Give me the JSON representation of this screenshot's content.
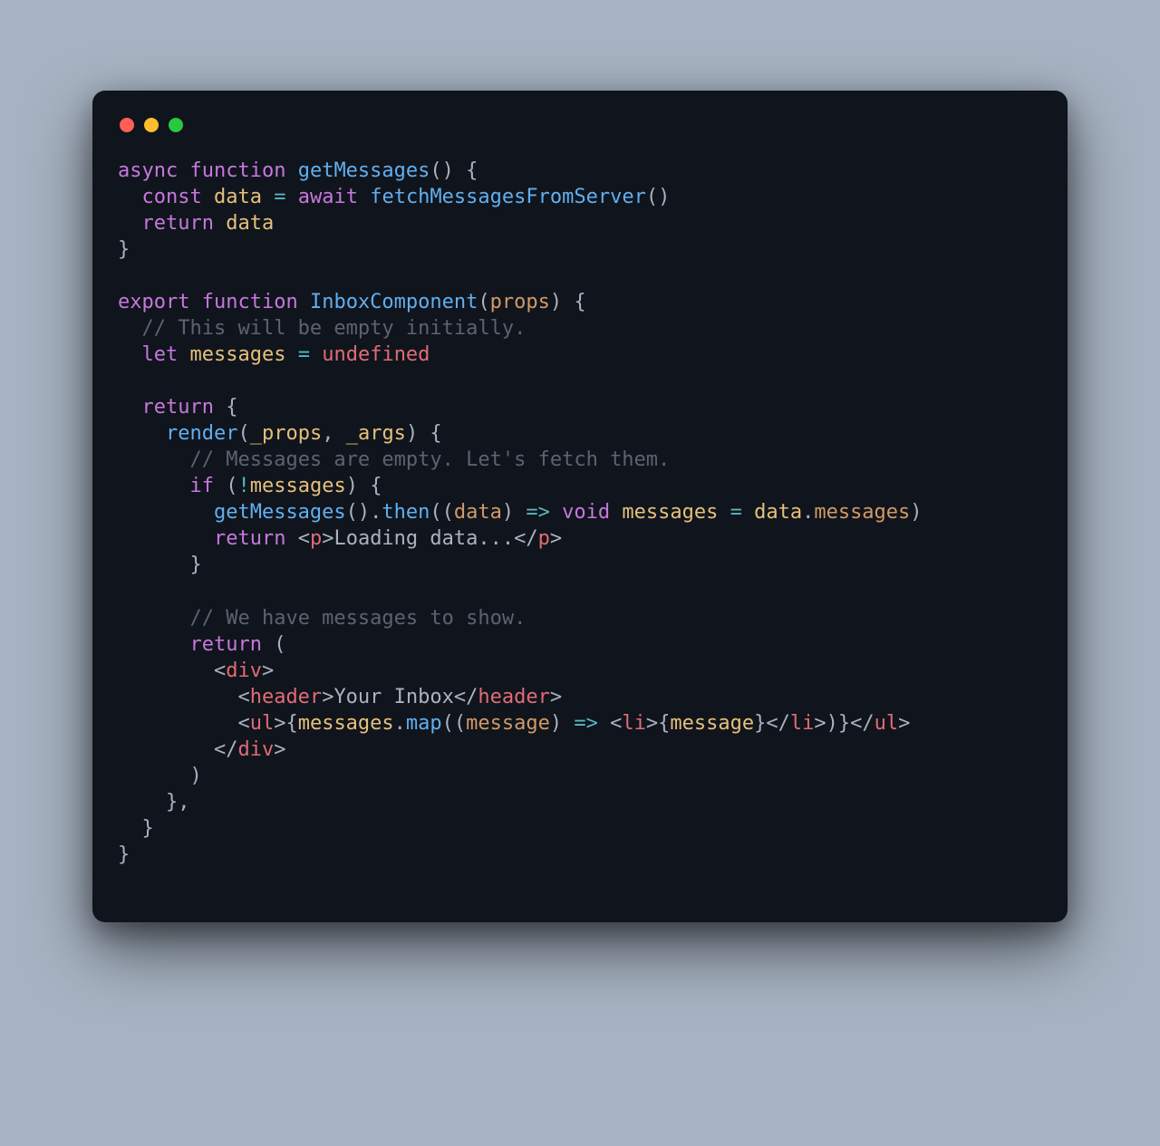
{
  "window": {
    "traffic_lights": [
      "red",
      "yellow",
      "green"
    ]
  },
  "code": {
    "lines": [
      [
        [
          "kw",
          "async"
        ],
        [
          "pn",
          " "
        ],
        [
          "kw",
          "function"
        ],
        [
          "pn",
          " "
        ],
        [
          "fn",
          "getMessages"
        ],
        [
          "pn",
          "() {"
        ]
      ],
      [
        [
          "pn",
          "  "
        ],
        [
          "kw",
          "const"
        ],
        [
          "pn",
          " "
        ],
        [
          "id",
          "data"
        ],
        [
          "pn",
          " "
        ],
        [
          "op",
          "="
        ],
        [
          "pn",
          " "
        ],
        [
          "kw",
          "await"
        ],
        [
          "pn",
          " "
        ],
        [
          "fn",
          "fetchMessagesFromServer"
        ],
        [
          "pn",
          "()"
        ]
      ],
      [
        [
          "pn",
          "  "
        ],
        [
          "kw",
          "return"
        ],
        [
          "pn",
          " "
        ],
        [
          "id",
          "data"
        ]
      ],
      [
        [
          "pn",
          "}"
        ]
      ],
      [],
      [
        [
          "kw",
          "export"
        ],
        [
          "pn",
          " "
        ],
        [
          "kw",
          "function"
        ],
        [
          "pn",
          " "
        ],
        [
          "fn",
          "InboxComponent"
        ],
        [
          "pn",
          "("
        ],
        [
          "prop",
          "props"
        ],
        [
          "pn",
          ") {"
        ]
      ],
      [
        [
          "pn",
          "  "
        ],
        [
          "cm",
          "// This will be empty initially."
        ]
      ],
      [
        [
          "pn",
          "  "
        ],
        [
          "kw",
          "let"
        ],
        [
          "pn",
          " "
        ],
        [
          "id",
          "messages"
        ],
        [
          "pn",
          " "
        ],
        [
          "op",
          "="
        ],
        [
          "pn",
          " "
        ],
        [
          "un",
          "undefined"
        ]
      ],
      [],
      [
        [
          "pn",
          "  "
        ],
        [
          "kw",
          "return"
        ],
        [
          "pn",
          " {"
        ]
      ],
      [
        [
          "pn",
          "    "
        ],
        [
          "fn",
          "render"
        ],
        [
          "pn",
          "("
        ],
        [
          "id",
          "_props"
        ],
        [
          "pn",
          ", "
        ],
        [
          "id",
          "_args"
        ],
        [
          "pn",
          ") {"
        ]
      ],
      [
        [
          "pn",
          "      "
        ],
        [
          "cm",
          "// Messages are empty. Let's fetch them."
        ]
      ],
      [
        [
          "pn",
          "      "
        ],
        [
          "kw",
          "if"
        ],
        [
          "pn",
          " ("
        ],
        [
          "op",
          "!"
        ],
        [
          "id",
          "messages"
        ],
        [
          "pn",
          ") {"
        ]
      ],
      [
        [
          "pn",
          "        "
        ],
        [
          "fn",
          "getMessages"
        ],
        [
          "pn",
          "()."
        ],
        [
          "fn",
          "then"
        ],
        [
          "pn",
          "(("
        ],
        [
          "prop",
          "data"
        ],
        [
          "pn",
          ") "
        ],
        [
          "op",
          "=>"
        ],
        [
          "pn",
          " "
        ],
        [
          "kw",
          "void"
        ],
        [
          "pn",
          " "
        ],
        [
          "id",
          "messages"
        ],
        [
          "pn",
          " "
        ],
        [
          "op",
          "="
        ],
        [
          "pn",
          " "
        ],
        [
          "id",
          "data"
        ],
        [
          "pn",
          "."
        ],
        [
          "prop",
          "messages"
        ],
        [
          "pn",
          ")"
        ]
      ],
      [
        [
          "pn",
          "        "
        ],
        [
          "kw",
          "return"
        ],
        [
          "pn",
          " "
        ],
        [
          "ang",
          "<"
        ],
        [
          "tag",
          "p"
        ],
        [
          "ang",
          ">"
        ],
        [
          "str",
          "Loading data..."
        ],
        [
          "ang",
          "</"
        ],
        [
          "tag",
          "p"
        ],
        [
          "ang",
          ">"
        ]
      ],
      [
        [
          "pn",
          "      }"
        ]
      ],
      [],
      [
        [
          "pn",
          "      "
        ],
        [
          "cm",
          "// We have messages to show."
        ]
      ],
      [
        [
          "pn",
          "      "
        ],
        [
          "kw",
          "return"
        ],
        [
          "pn",
          " ("
        ]
      ],
      [
        [
          "pn",
          "        "
        ],
        [
          "ang",
          "<"
        ],
        [
          "tag",
          "div"
        ],
        [
          "ang",
          ">"
        ]
      ],
      [
        [
          "pn",
          "          "
        ],
        [
          "ang",
          "<"
        ],
        [
          "tag",
          "header"
        ],
        [
          "ang",
          ">"
        ],
        [
          "str",
          "Your Inbox"
        ],
        [
          "ang",
          "</"
        ],
        [
          "tag",
          "header"
        ],
        [
          "ang",
          ">"
        ]
      ],
      [
        [
          "pn",
          "          "
        ],
        [
          "ang",
          "<"
        ],
        [
          "tag",
          "ul"
        ],
        [
          "ang",
          ">"
        ],
        [
          "pn",
          "{"
        ],
        [
          "id",
          "messages"
        ],
        [
          "pn",
          "."
        ],
        [
          "fn",
          "map"
        ],
        [
          "pn",
          "(("
        ],
        [
          "prop",
          "message"
        ],
        [
          "pn",
          ") "
        ],
        [
          "op",
          "=>"
        ],
        [
          "pn",
          " "
        ],
        [
          "ang",
          "<"
        ],
        [
          "tag",
          "li"
        ],
        [
          "ang",
          ">"
        ],
        [
          "pn",
          "{"
        ],
        [
          "id",
          "message"
        ],
        [
          "pn",
          "}"
        ],
        [
          "ang",
          "</"
        ],
        [
          "tag",
          "li"
        ],
        [
          "ang",
          ">"
        ],
        [
          "pn",
          ")}"
        ],
        [
          "ang",
          "</"
        ],
        [
          "tag",
          "ul"
        ],
        [
          "ang",
          ">"
        ]
      ],
      [
        [
          "pn",
          "        "
        ],
        [
          "ang",
          "</"
        ],
        [
          "tag",
          "div"
        ],
        [
          "ang",
          ">"
        ]
      ],
      [
        [
          "pn",
          "      )"
        ]
      ],
      [
        [
          "pn",
          "    },"
        ]
      ],
      [
        [
          "pn",
          "  }"
        ]
      ],
      [
        [
          "pn",
          "}"
        ]
      ]
    ]
  }
}
